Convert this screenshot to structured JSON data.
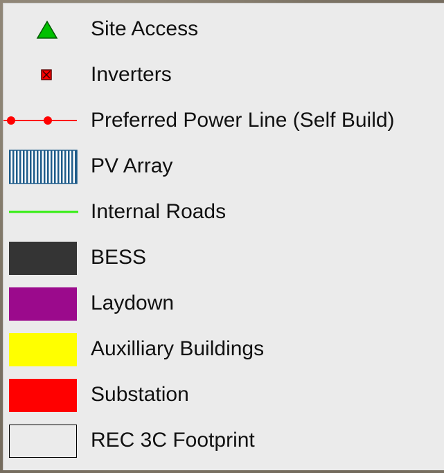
{
  "legend": {
    "items": [
      {
        "label": "Site Access",
        "symbol": "green-triangle",
        "color": "#00c000"
      },
      {
        "label": "Inverters",
        "symbol": "red-square-with-x",
        "color": "#ff0000"
      },
      {
        "label": "Preferred Power Line (Self Build)",
        "symbol": "red-line-with-dots",
        "color": "#ff0000"
      },
      {
        "label": "PV Array",
        "symbol": "blue-vertical-hatch",
        "color": "#1f5c8a"
      },
      {
        "label": "Internal Roads",
        "symbol": "green-line",
        "color": "#33ee11"
      },
      {
        "label": "BESS",
        "symbol": "fill",
        "color": "#343434"
      },
      {
        "label": "Laydown",
        "symbol": "fill",
        "color": "#9b0a8c"
      },
      {
        "label": "Auxilliary Buildings",
        "symbol": "fill",
        "color": "#ffff00"
      },
      {
        "label": "Substation",
        "symbol": "fill",
        "color": "#ff0000"
      },
      {
        "label": "REC 3C Footprint",
        "symbol": "outline",
        "color": "#000000"
      }
    ]
  }
}
